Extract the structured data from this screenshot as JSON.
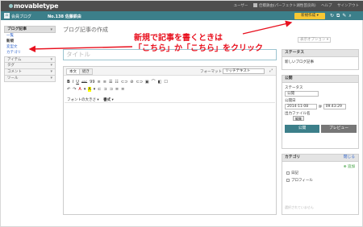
{
  "header": {
    "logo": "movabletype",
    "userlinks": [
      "ユーザー",
      "佳積鉄由(パーフェクト湖性芸良商)",
      "ヘルプ",
      "サインアウト"
    ]
  },
  "blogbar": {
    "name": "会員ブログ",
    "number": "No.138 佐藤鉄由",
    "new_button": "新規作成 ▾",
    "icons": [
      "refresh-icon",
      "external-icon",
      "edit-icon",
      "search-icon"
    ]
  },
  "sidebar": {
    "section": "ブログ記事",
    "items": [
      "一覧",
      "新規",
      "変型文",
      "カテゴリ"
    ],
    "menus": [
      "アイテム",
      "タグ",
      "コメント",
      "ツール"
    ]
  },
  "main": {
    "page_title": "ブログ記事の作成",
    "display_options": "表示オプション ▾",
    "title_placeholder": "タイトル",
    "tabs": [
      "本文",
      "続き"
    ],
    "format_label": "フォーマット",
    "format_value": "リッチテキスト",
    "toolbar1": [
      "B",
      "I",
      "U",
      "ABC",
      "99",
      "≡",
      "≡",
      "☰",
      "☷",
      "⊂⊃",
      "⊘",
      "⊂⊃",
      "▣",
      "⌒",
      "◧",
      "☐"
    ],
    "toolbar2": [
      "↶",
      "↷",
      "A",
      "▾",
      "A",
      "▾",
      "⊏",
      "⊐",
      "⊐",
      "≡",
      "≡"
    ],
    "font_size_label": "フォントの大きさ",
    "font_family_label": "書式"
  },
  "annotation": {
    "line1": "新規で記事を書くときは",
    "line2": "「こちら」か「こちら」をクリック",
    "color": "#e8101e"
  },
  "right": {
    "status": {
      "title": "ステータス",
      "text": "新しいブログ記事"
    },
    "publish": {
      "title": "公開",
      "status_label": "ステータス",
      "status_value": "公開",
      "date_label": "公開日",
      "date_value": "2014-11-08",
      "time_value": "09:43:29",
      "filename_label": "出力ファイル名",
      "edit_button": "編集",
      "publish_button": "公開",
      "preview_button": "プレビュー"
    },
    "category": {
      "title": "カテゴリ",
      "close": "閉じる",
      "add": "⊕ 追加",
      "items": [
        "日記",
        "プロフィール"
      ],
      "footer": "選択されていません"
    }
  }
}
